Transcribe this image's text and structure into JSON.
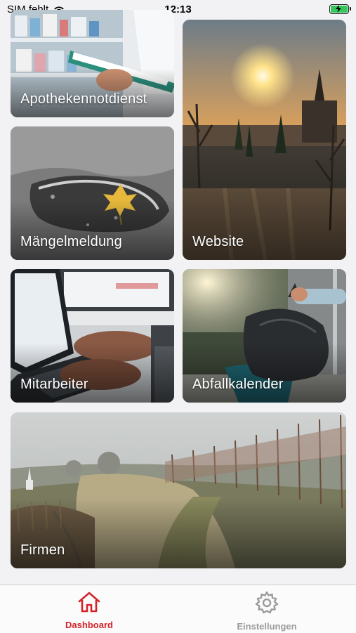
{
  "status_bar": {
    "carrier": "SIM fehlt",
    "time": "12:13"
  },
  "tiles": [
    {
      "label": "Apothekennotdienst"
    },
    {
      "label": "Website"
    },
    {
      "label": "Mängelmeldung"
    },
    {
      "label": "Mitarbeiter"
    },
    {
      "label": "Abfallkalender"
    },
    {
      "label": "Firmen"
    }
  ],
  "tab_bar": {
    "items": [
      {
        "label": "Dashboard",
        "icon": "house-icon",
        "active": true
      },
      {
        "label": "Einstellungen",
        "icon": "gear-icon",
        "active": false
      }
    ],
    "active_color": "#d3232a",
    "inactive_color": "#9b9b9b"
  }
}
